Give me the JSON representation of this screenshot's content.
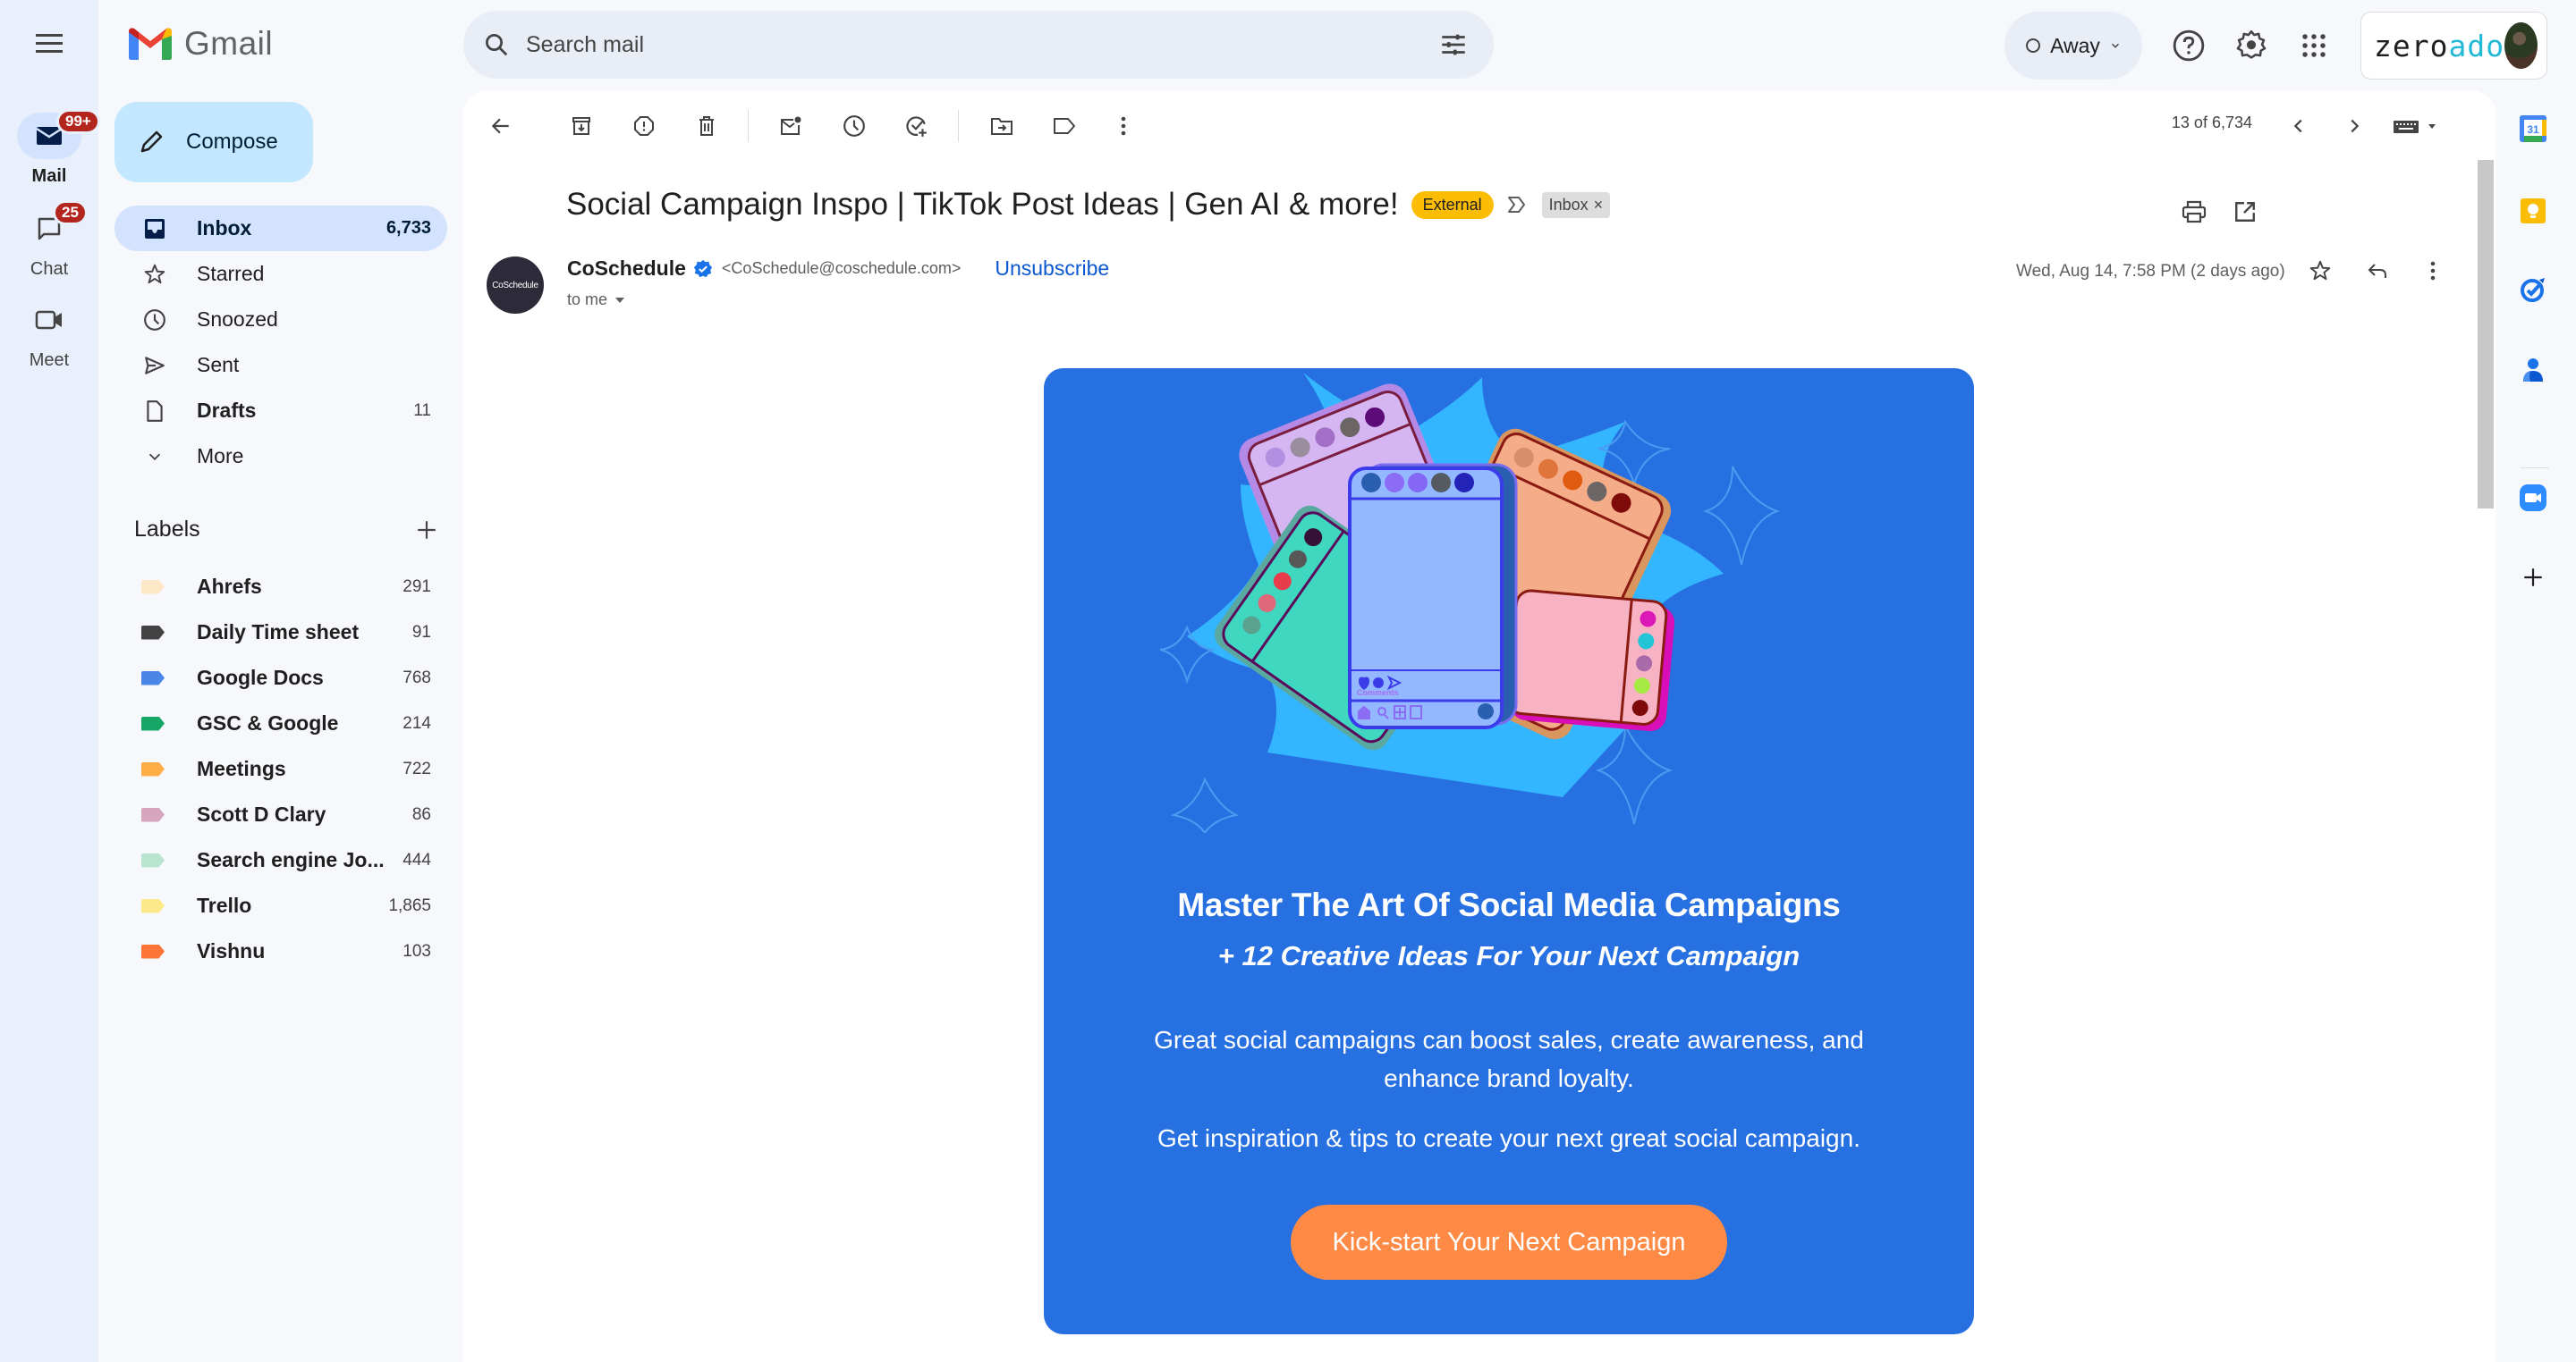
{
  "app": {
    "name": "Gmail"
  },
  "rail": {
    "items": [
      {
        "label": "Mail",
        "badge": "99+",
        "icon": "mail-icon",
        "active": true
      },
      {
        "label": "Chat",
        "badge": "25",
        "icon": "chat-icon",
        "active": false
      },
      {
        "label": "Meet",
        "badge": "",
        "icon": "video-icon",
        "active": false
      }
    ]
  },
  "sidebar": {
    "compose_label": "Compose",
    "nav": [
      {
        "label": "Inbox",
        "count": "6,733",
        "icon": "inbox-icon"
      },
      {
        "label": "Starred",
        "count": "",
        "icon": "star-icon"
      },
      {
        "label": "Snoozed",
        "count": "",
        "icon": "clock-icon"
      },
      {
        "label": "Sent",
        "count": "",
        "icon": "send-icon"
      },
      {
        "label": "Drafts",
        "count": "11",
        "icon": "draft-icon"
      },
      {
        "label": "More",
        "count": "",
        "icon": "chevron-down-icon"
      }
    ],
    "labels_title": "Labels",
    "labels": [
      {
        "name": "Ahrefs",
        "count": "291",
        "color": "#fde7c7"
      },
      {
        "name": "Daily Time sheet",
        "count": "91",
        "color": "#434343"
      },
      {
        "name": "Google Docs",
        "count": "768",
        "color": "#4a86e8"
      },
      {
        "name": "GSC & Google",
        "count": "214",
        "color": "#16a766"
      },
      {
        "name": "Meetings",
        "count": "722",
        "color": "#ffad47"
      },
      {
        "name": "Scott D Clary",
        "count": "86",
        "color": "#d5a6bd"
      },
      {
        "name": "Search engine Jo...",
        "count": "444",
        "color": "#b9e4d0"
      },
      {
        "name": "Trello",
        "count": "1,865",
        "color": "#fce98a"
      },
      {
        "name": "Vishnu",
        "count": "103",
        "color": "#ff7537"
      }
    ]
  },
  "topbar": {
    "search_placeholder": "Search mail",
    "status": "Away",
    "account_brand_a": "zero",
    "account_brand_b": "ado"
  },
  "toolbar": {
    "pager": "13 of 6,734"
  },
  "email": {
    "subject": "Social Campaign Inspo | TikTok Post Ideas | Gen AI & more!",
    "chip_external": "External",
    "chip_inbox": "Inbox",
    "chip_close": "×",
    "sender_avatar_text": "CoSchedule",
    "sender_name": "CoSchedule",
    "sender_email": "<CoSchedule@coschedule.com>",
    "unsubscribe": "Unsubscribe",
    "to": "to me",
    "date": "Wed, Aug 14, 7:58 PM (2 days ago)",
    "body": {
      "headline": "Master The Art Of Social Media Campaigns",
      "subhead": "+ 12 Creative Ideas For Your Next Campaign",
      "para1": "Great social campaigns can boost sales, create awareness, and enhance brand loyalty.",
      "para2": "Get inspiration & tips to create your next great social campaign.",
      "cta": "Kick-start Your Next Campaign",
      "illustration_caption": "Comments"
    }
  },
  "colors": {
    "card_bg": "#2670e2",
    "cta_bg": "#ff8a45",
    "external_chip": "#fbbc04",
    "link": "#0b57d0"
  }
}
